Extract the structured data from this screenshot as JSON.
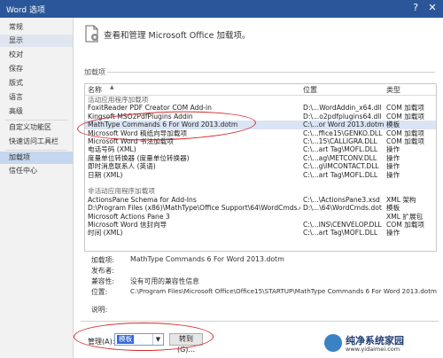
{
  "window": {
    "title": "Word 选项",
    "controls": [
      "?",
      "✕"
    ]
  },
  "sidebar": {
    "items": [
      {
        "label": "常规"
      },
      {
        "label": "显示"
      },
      {
        "label": "校对"
      },
      {
        "label": "保存"
      },
      {
        "label": "版式"
      },
      {
        "label": "语言"
      },
      {
        "label": "高级"
      },
      {
        "label": "自定义功能区"
      },
      {
        "label": "快速访问工具栏"
      },
      {
        "label": "加载项"
      },
      {
        "label": "信任中心"
      }
    ],
    "selected_index": 9
  },
  "header": {
    "text": "查看和管理 Microsoft Office 加载项。"
  },
  "section": {
    "label": "加载项"
  },
  "grid": {
    "columns": {
      "name": "名称",
      "location": "位置",
      "type": "类型"
    },
    "rows": [
      {
        "name": "活动应用程序加载项",
        "location": "",
        "type": "",
        "group": true
      },
      {
        "name": "FoxitReader PDF Creator COM Add-in",
        "location": "D:\\...WordAddin_x64.dll",
        "type": "COM 加载项"
      },
      {
        "name": "Kingsoft MSO2PdfPlugins Addin",
        "location": "D:\\...o2pdfplugins64.dll",
        "type": "COM 加载项"
      },
      {
        "name": "MathType Commands 6 For Word 2013.dotm",
        "location": "C:\\...or Word 2013.dotm",
        "type": "模板",
        "selected": true
      },
      {
        "name": "Microsoft Word 稿纸向导加载项",
        "location": "C:\\...ffice15\\GENKO.DLL",
        "type": "COM 加载项"
      },
      {
        "name": "Microsoft Word 书法加载项",
        "location": "C:\\...15\\CALLIGRA.DLL",
        "type": "COM 加载项"
      },
      {
        "name": "电话号码 (XML)",
        "location": "C:\\...art Tag\\MOFL.DLL",
        "type": "操作"
      },
      {
        "name": "度量单位转换器 (度量单位转换器)",
        "location": "C:\\...ag\\METCONV.DLL",
        "type": "操作"
      },
      {
        "name": "即时消息联系人 (英语)",
        "location": "C:\\...g\\IMCONTACT.DLL",
        "type": "操作"
      },
      {
        "name": "日期 (XML)",
        "location": "C:\\...art Tag\\MOFL.DLL",
        "type": "操作"
      },
      {
        "name": "",
        "location": "",
        "type": ""
      },
      {
        "name": "非活动应用程序加载项",
        "location": "",
        "type": "",
        "group": true
      },
      {
        "name": "ActionsPane Schema for Add-Ins",
        "location": "C:\\...\\ActionsPane3.xsd",
        "type": "XML 架构"
      },
      {
        "name": "D:\\Program Files (x86)\\MathType\\Office Support\\64\\WordCmds.dot",
        "location": "D:\\...\\64\\WordCmds.dot",
        "type": "模板"
      },
      {
        "name": "Microsoft Actions Pane 3",
        "location": "",
        "type": "XML 扩展包"
      },
      {
        "name": "Microsoft Word 信封向导",
        "location": "C:\\...INS\\CENVELOP.DLL",
        "type": "COM 加载项"
      },
      {
        "name": "时间 (XML)",
        "location": "C:\\...art Tag\\MOFL.DLL",
        "type": "操作"
      }
    ]
  },
  "details": {
    "addin": {
      "key": "加载项:",
      "value": "MathType Commands 6 For Word 2013.dotm"
    },
    "publisher": {
      "key": "发布者:",
      "value": ""
    },
    "compat": {
      "key": "兼容性:",
      "value": "没有可用的兼容性信息"
    },
    "location": {
      "key": "位置:",
      "value": "C:\\Program Files\\Microsoft Office\\Office15\\STARTUP\\MathType Commands 6 For Word 2013.dotm"
    },
    "description": {
      "key": "说明:",
      "value": ""
    }
  },
  "manage": {
    "label": "管理(A):",
    "selected": "模板",
    "goto_label": "转到(G)..."
  },
  "watermark": {
    "title": "纯净系统家园",
    "url": "www.yidaimei.com"
  },
  "colors": {
    "titlebar": "#2b579a",
    "selection": "#c5d7ee",
    "annotation": "#d32b2b",
    "dropdown_highlight": "#3367d6"
  }
}
